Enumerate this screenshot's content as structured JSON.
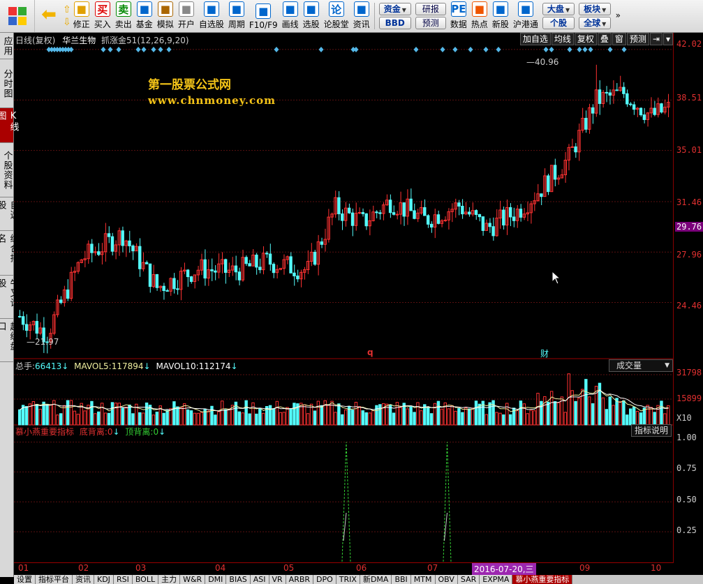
{
  "toolbar": {
    "buttons": [
      {
        "label": "修正",
        "icon": "refresh-icon",
        "color": "#e0a000"
      },
      {
        "label": "买入",
        "icon": "buy-icon",
        "color": "#d00",
        "glyph": "买"
      },
      {
        "label": "卖出",
        "icon": "sell-icon",
        "color": "#080",
        "glyph": "卖"
      },
      {
        "label": "基金",
        "icon": "fund-icon",
        "color": "#06c"
      },
      {
        "label": "模拟",
        "icon": "hammer-icon",
        "color": "#a60"
      },
      {
        "label": "开户",
        "icon": "lock-icon",
        "color": "#888"
      },
      {
        "label": "自选股",
        "icon": "star-icon",
        "color": "#06c"
      },
      {
        "label": "周期",
        "icon": "clock-icon",
        "color": "#06c"
      },
      {
        "label": "F10/F9",
        "icon": "f10-icon",
        "color": "#06c"
      },
      {
        "label": "画线",
        "icon": "pen-icon",
        "color": "#06c"
      },
      {
        "label": "选股",
        "icon": "monitor-icon",
        "color": "#06c"
      },
      {
        "label": "论股堂",
        "icon": "discuss-icon",
        "color": "#06c",
        "glyph": "论"
      },
      {
        "label": "资讯",
        "icon": "news-icon",
        "color": "#06c"
      },
      {
        "label": "数据",
        "icon": "pe-icon",
        "color": "#06c",
        "glyph": "PE"
      },
      {
        "label": "热点",
        "icon": "hot-icon",
        "color": "#e50"
      },
      {
        "label": "新股",
        "icon": "newstock-icon",
        "color": "#06c"
      },
      {
        "label": "沪港通",
        "icon": "hk-icon",
        "color": "#06c"
      }
    ],
    "pills_a": [
      "资金",
      "BBD"
    ],
    "pills_b": [
      "研报",
      "预测"
    ],
    "pills_c": [
      "大盘",
      "个股"
    ],
    "pills_d": [
      "板块",
      "全球"
    ]
  },
  "sidetabs": [
    "应用",
    "分时图",
    "K线图",
    "个股资料",
    "自选股",
    "综合排名",
    "牛叉诊股",
    "超级盘口"
  ],
  "price": {
    "header": "日线(复权)",
    "stock": "华兰生物",
    "indicator": "抓涨金51(12,26,9,20)",
    "buttons": [
      "加自选",
      "均线",
      "复权",
      "叠",
      "窗",
      "预测"
    ],
    "high_label": "40.96",
    "low_label": "21.97",
    "marker_q": "q",
    "marker_cai": "财",
    "yticks": [
      "42.02",
      "38.51",
      "35.01",
      "31.46",
      "27.96",
      "24.46"
    ],
    "current": "29.76"
  },
  "watermark": {
    "line1": "第一股票公式网",
    "line2": "www.chnmoney.com"
  },
  "volume": {
    "label": "总手:",
    "value": "66413",
    "ma5_label": "MAVOL5:",
    "ma5": "117894",
    "ma10_label": "MAVOL10:",
    "ma10": "112174",
    "selector": "成交量",
    "yticks": [
      "31798",
      "15899",
      "X10"
    ]
  },
  "indicator": {
    "name": "慕小燕重要指标",
    "f1_label": "底背离:",
    "f1": "0",
    "f2_label": "顶背离:",
    "f2": "0",
    "button": "指标说明",
    "yticks": [
      "1.00",
      "0.75",
      "0.50",
      "0.25"
    ]
  },
  "xaxis": {
    "labels": [
      "01",
      "02",
      "03",
      "04",
      "05",
      "06",
      "07",
      "08",
      "09",
      "10"
    ],
    "cursor_date": "2016-07-20,三"
  },
  "bottomtabs": [
    "设置",
    "指标平台",
    "资讯",
    "KDJ",
    "RSI",
    "BOLL",
    "主力",
    "W&R",
    "DMI",
    "BIAS",
    "ASI",
    "VR",
    "ARBR",
    "DPO",
    "TRIX",
    "新DMA",
    "BBI",
    "MTM",
    "OBV",
    "SAR",
    "EXPMA",
    "慕小燕重要指标"
  ],
  "chart_data": {
    "type": "candlestick",
    "price_ylim": [
      21.0,
      42.5
    ],
    "volume_ylim": [
      0,
      33000
    ],
    "indicator_ylim": [
      0,
      1.05
    ],
    "low_point": 21.97,
    "high_point": 40.96,
    "signal_months": [
      "06",
      "07"
    ]
  },
  "colors": {
    "up": "#ff3232",
    "down": "#54fcfc",
    "grid": "#5a1010",
    "accent": "#e03030"
  }
}
